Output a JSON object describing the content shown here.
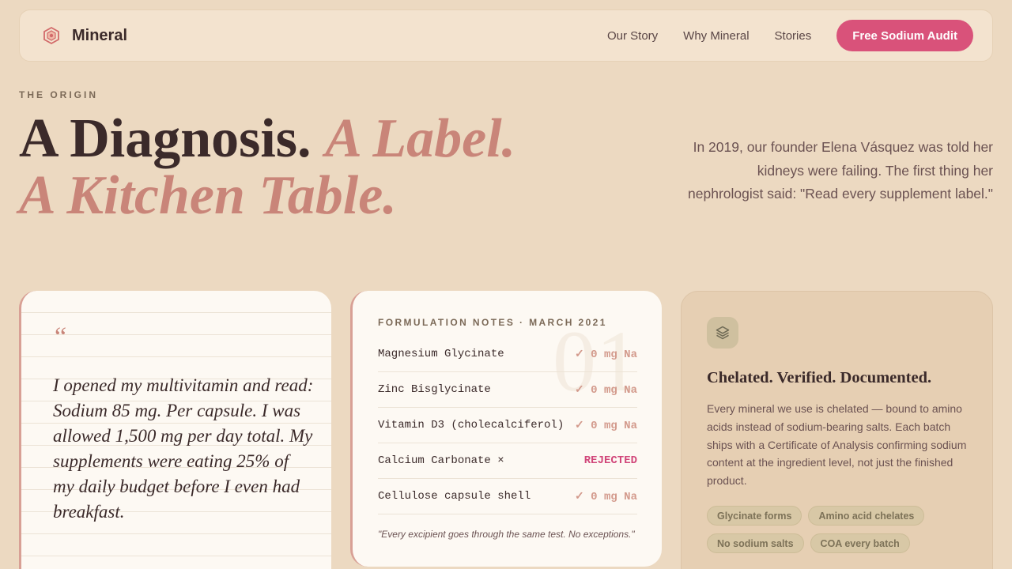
{
  "nav": {
    "brand": "Mineral",
    "links": [
      "Our Story",
      "Why Mineral",
      "Stories"
    ],
    "cta": "Free Sodium Audit"
  },
  "hero": {
    "eyebrow": "THE ORIGIN",
    "headline_strong": "A Diagnosis.",
    "headline_soft_1": "A Label.",
    "headline_soft_2": "A Kitchen Table.",
    "side_text": "In 2019, our founder Elena Vásquez was told her kidneys were failing. The first thing her nephrologist said: \"Read every supplement label.\""
  },
  "quote_card": {
    "mark": "“",
    "text": "I opened my multivitamin and read: Sodium 85 mg. Per capsule. I was allowed 1,500 mg per day total. My supplements were eating 25% of my daily budget before I even had breakfast."
  },
  "notes_card": {
    "watermark": "01",
    "title": "FORMULATION NOTES · MARCH 2021",
    "rows": [
      {
        "name": "Magnesium Glycinate",
        "status": "✓ 0 mg Na"
      },
      {
        "name": "Zinc Bisglycinate",
        "status": "✓ 0 mg Na"
      },
      {
        "name": "Vitamin D3 (cholecalciferol)",
        "status": "✓ 0 mg Na"
      },
      {
        "name": "Calcium Carbonate ×",
        "status": "REJECTED"
      },
      {
        "name": "Cellulose capsule shell",
        "status": "✓ 0 mg Na"
      }
    ],
    "footer": "\"Every excipient goes through the same test. No exceptions.\""
  },
  "feature_card": {
    "icon": "layers-icon",
    "title": "Chelated. Verified. Documented.",
    "description": "Every mineral we use is chelated — bound to amino acids instead of sodium-bearing salts. Each batch ships with a Certificate of Analysis confirming sodium content at the ingredient level, not just the finished product.",
    "tags": [
      "Glycinate forms",
      "Amino acid chelates",
      "No sodium salts",
      "COA every batch"
    ]
  },
  "colors": {
    "background": "#ecd9c1",
    "accent": "#d9527a",
    "soft_accent": "#c98579",
    "text": "#3b2a2a"
  }
}
